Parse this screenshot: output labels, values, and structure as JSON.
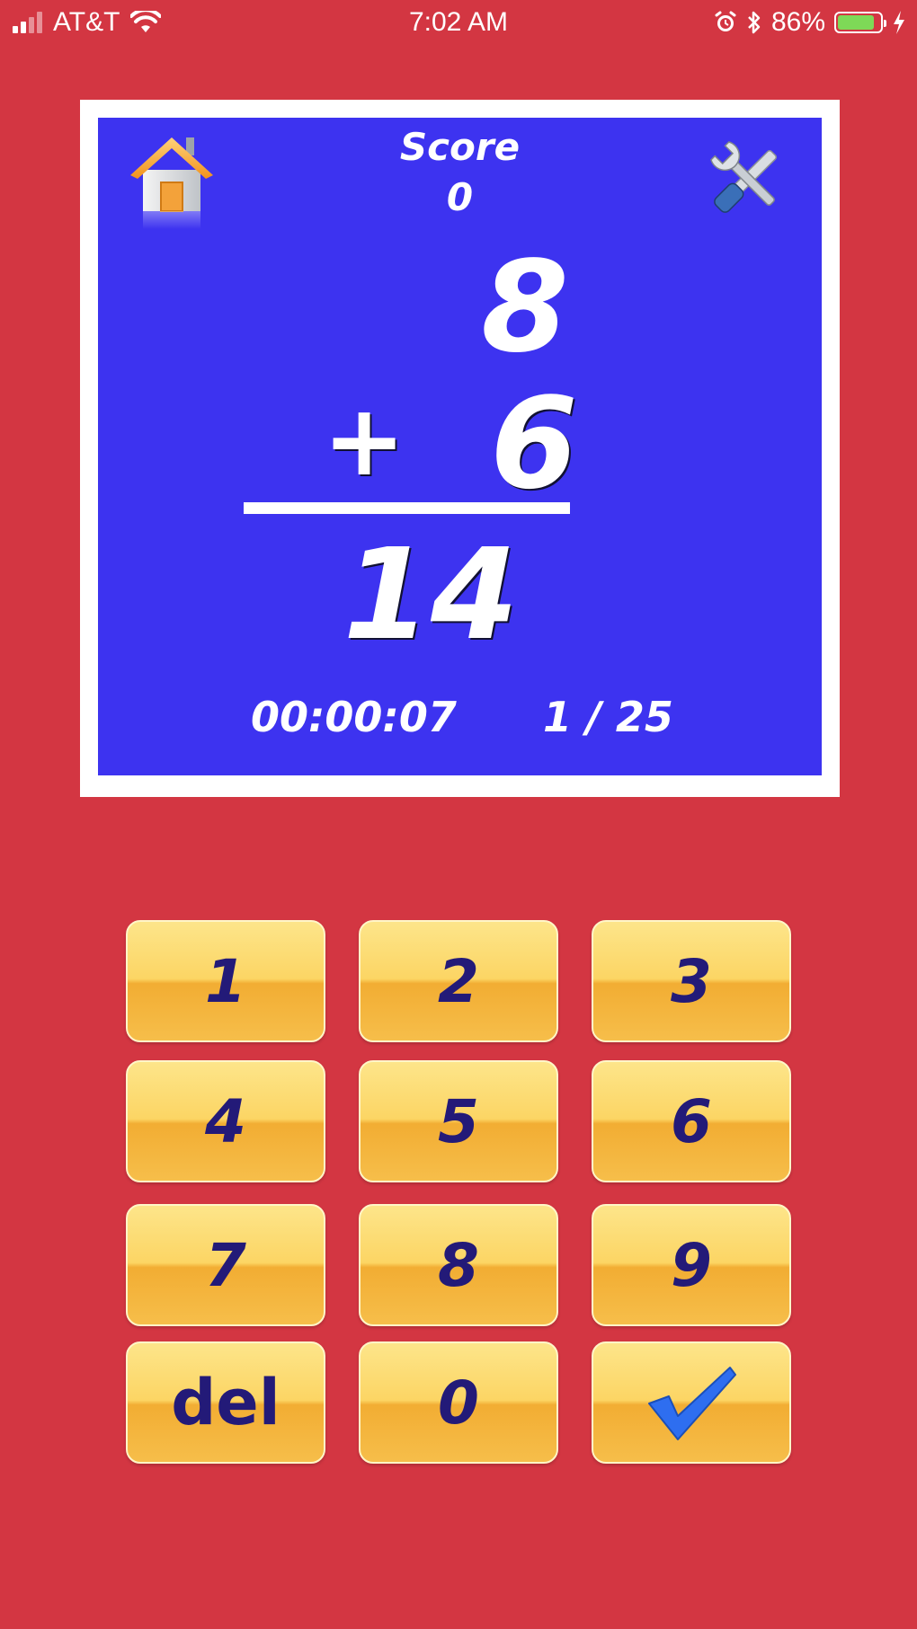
{
  "status_bar": {
    "carrier": "AT&T",
    "time": "7:02 AM",
    "battery_percent": "86%",
    "battery_level": 0.86
  },
  "game": {
    "score_label": "Score",
    "score_value": "0",
    "top_number": "8",
    "operator": "+",
    "bottom_number": "6",
    "answer": "14",
    "timer": "00:00:07",
    "progress": "1 / 25"
  },
  "keypad": {
    "keys": [
      "1",
      "2",
      "3",
      "4",
      "5",
      "6",
      "7",
      "8",
      "9",
      "del",
      "0"
    ],
    "submit_icon": "checkmark-icon"
  },
  "colors": {
    "background": "#d33642",
    "card": "#3d33f0",
    "key_text": "#231a78",
    "check": "#2e6ef0"
  }
}
